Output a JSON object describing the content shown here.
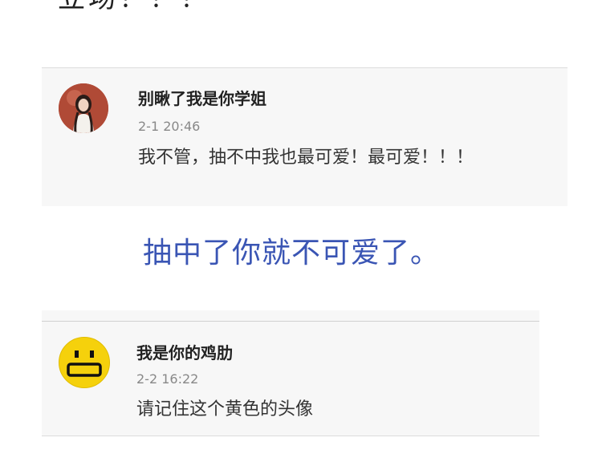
{
  "top_fragment": "立场！！！",
  "comments": [
    {
      "username": "别瞅了我是你学姐",
      "time": "2-1 20:46",
      "text": "我不管，抽不中我也最可爱！最可爱！！！",
      "avatar_icon": "portrait-photo"
    },
    {
      "username": "我是你的鸡肋",
      "time": "2-2 16:22",
      "text": "请记住这个黄色的头像",
      "avatar_icon": "yellow-smiley"
    }
  ],
  "caption": "抽中了你就不可爱了。",
  "colors": {
    "caption": "#3a55b4",
    "card_bg": "#f7f7f7",
    "smiley_yellow": "#f5d10c"
  }
}
